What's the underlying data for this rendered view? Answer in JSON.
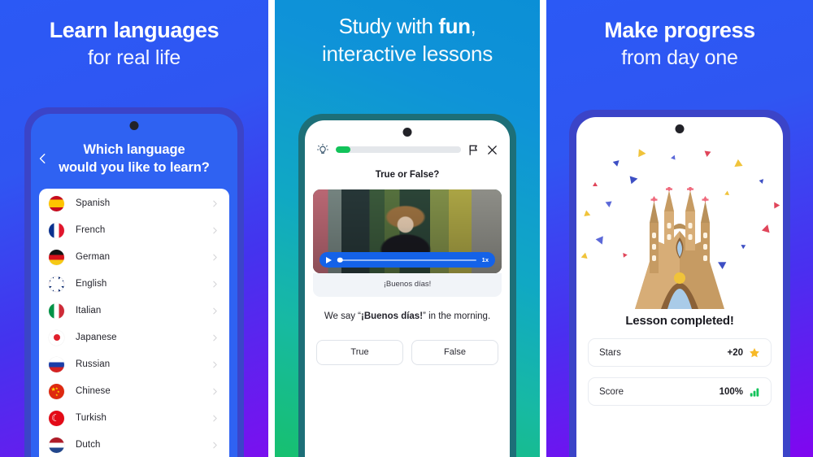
{
  "panels": [
    {
      "headline_line1": "Learn languages",
      "headline_line2": "for real life",
      "screen": {
        "title_line1": "Which language",
        "title_line2": "would you like to learn?",
        "back_icon": "chevron-left-icon",
        "languages": [
          {
            "name": "Spanish",
            "flag": "flag-spain",
            "chevron": "chevron-right-icon"
          },
          {
            "name": "French",
            "flag": "flag-france",
            "chevron": "chevron-right-icon"
          },
          {
            "name": "German",
            "flag": "flag-germany",
            "chevron": "chevron-right-icon"
          },
          {
            "name": "English",
            "flag": "flag-uk",
            "chevron": "chevron-right-icon"
          },
          {
            "name": "Italian",
            "flag": "flag-italy",
            "chevron": "chevron-right-icon"
          },
          {
            "name": "Japanese",
            "flag": "flag-japan",
            "chevron": "chevron-right-icon"
          },
          {
            "name": "Russian",
            "flag": "flag-russia",
            "chevron": "chevron-right-icon"
          },
          {
            "name": "Chinese",
            "flag": "flag-china",
            "chevron": "chevron-right-icon"
          },
          {
            "name": "Turkish",
            "flag": "flag-turkey",
            "chevron": "chevron-right-icon"
          },
          {
            "name": "Dutch",
            "flag": "flag-netherlands",
            "chevron": "chevron-right-icon"
          }
        ]
      }
    },
    {
      "headline_part1": "Study with ",
      "headline_bold": "fun",
      "headline_part2": ",",
      "headline_line2": "interactive lessons",
      "screen": {
        "hint_icon": "lightbulb-icon",
        "progress_percent": 12,
        "flag_icon": "flag-report-icon",
        "close_icon": "close-icon",
        "question_type": "True or False?",
        "video": {
          "play_icon": "play-icon",
          "scrub_position_percent": 2,
          "speed_label": "1x",
          "caption": "¡Buenos días!"
        },
        "statement_prefix": "We say “",
        "statement_bold": "¡Buenos días!",
        "statement_suffix": "” in the morning.",
        "answers": [
          "True",
          "False"
        ]
      }
    },
    {
      "headline_line1": "Make progress",
      "headline_line2": "from day one",
      "screen": {
        "illustration": "sagrada-familia-icon",
        "title": "Lesson completed!",
        "stats": [
          {
            "label": "Stars",
            "value": "+20",
            "icon": "star-icon"
          },
          {
            "label": "Score",
            "value": "100%",
            "icon": "bar-chart-icon"
          }
        ]
      }
    }
  ],
  "colors": {
    "blue": "#2b59f5",
    "violet": "#7a10ef",
    "teal": "#17b9a4",
    "green": "#12c35a",
    "star_yellow": "#f7b928",
    "video_blue": "#1462e8"
  }
}
